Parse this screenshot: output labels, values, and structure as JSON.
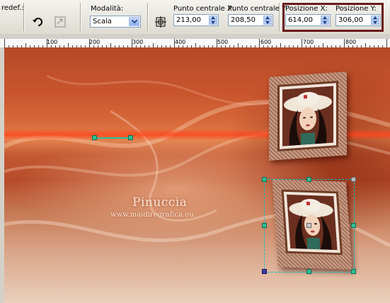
{
  "toolbar": {
    "preset_label_partial": "redef.:",
    "modalita_label": "Modalità:",
    "modalita_value": "Scala",
    "punto_centrale_x_label": "Punto centrale X:",
    "punto_centrale_x_value": "213,00",
    "punto_centrale_y_label": "Punto centrale Y:",
    "punto_centrale_y_value": "208,50",
    "posizione_x_label": "Posizione X:",
    "posizione_x_value": "614,00",
    "posizione_y_label": "Posizione Y:",
    "posizione_y_value": "306,00",
    "icons": [
      "rotate-arrow-icon",
      "reset-transform-icon",
      "center-target-icon"
    ]
  },
  "ruler": {
    "labels": [
      "100",
      "200",
      "300",
      "400",
      "500",
      "600",
      "700",
      "800"
    ]
  },
  "canvas": {
    "watermark_title": "Pinuccia",
    "watermark_url": "www.maidiregrafica.eu"
  },
  "colors": {
    "highlight_border": "#6b1a1a",
    "handle": "#2fbf94",
    "selection_outline": "#00c8c8"
  }
}
